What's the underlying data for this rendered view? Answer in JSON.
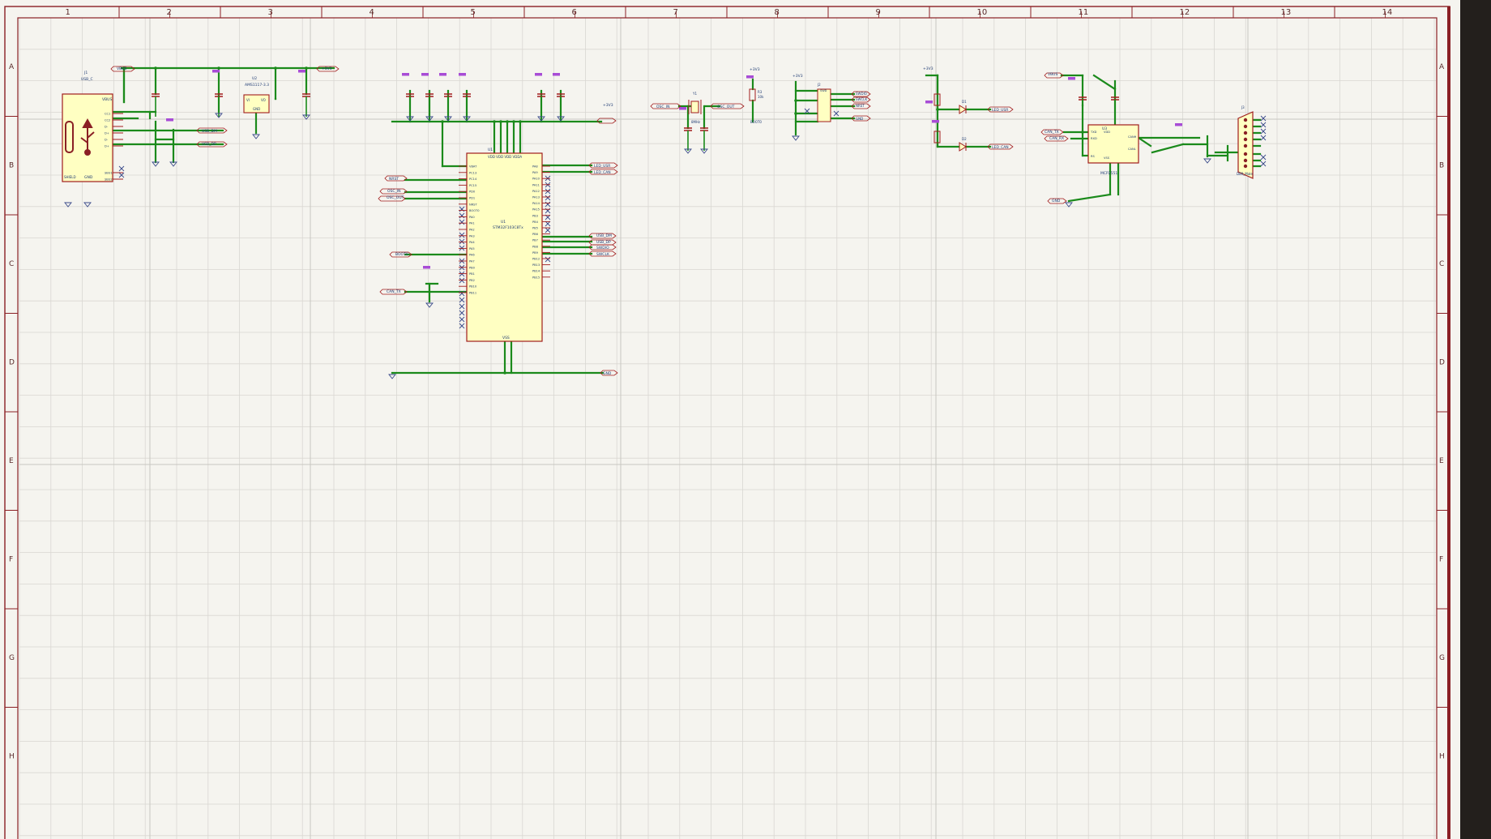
{
  "colors": {
    "background": "#f5f4ef",
    "frame": "#8a1f24",
    "grid": "#d9d7d2",
    "wire": "#1b8a1b",
    "component_fill": "#ffffc2",
    "component_stroke": "#a11d1d",
    "text": "#1f3b73",
    "power_flag": "#a84cd6",
    "no_connect": "#3a4a8a",
    "panel": "#231f1c"
  },
  "frame": {
    "columns": [
      "1",
      "2",
      "3",
      "4",
      "5",
      "6",
      "7",
      "8",
      "9",
      "10",
      "11",
      "12",
      "13",
      "14"
    ],
    "rows": [
      "A",
      "B",
      "C",
      "D",
      "E",
      "F",
      "G",
      "H"
    ]
  },
  "components": {
    "usb": {
      "ref": "J1",
      "value": "USB_C",
      "power_pin": "VBUS",
      "ground_pin": "GND",
      "shield_label": "SHIELD",
      "pins": [
        "CC1",
        "CC2",
        "D-",
        "D+",
        "D-",
        "D+",
        "SBU1",
        "SBU2"
      ]
    },
    "ldo": {
      "ref": "U2",
      "value": "AMS1117-3.3",
      "pin_in": "VI",
      "pin_out": "VO",
      "pin_gnd": "GND"
    },
    "mcu": {
      "ref": "U1",
      "value": "STM32F103C8Tx",
      "top_label": "VDD VDD VDD VDDA",
      "power_label": "VBAT",
      "ground_label": "VSS",
      "left_pins": [
        "VBAT",
        "PC13",
        "PC14",
        "PC15",
        "PD0",
        "PD1",
        "NRST",
        "BOOT0",
        "PA0",
        "PA1",
        "PA2",
        "PA3",
        "PA4",
        "PA5",
        "PA6",
        "PA7",
        "PB0",
        "PB1",
        "PB2",
        "PB10",
        "PB11"
      ],
      "right_pins": [
        "PA8",
        "PA9",
        "PA10",
        "PA11",
        "PA12",
        "PA13",
        "PA14",
        "PA15",
        "PB3",
        "PB4",
        "PB5",
        "PB6",
        "PB7",
        "PB8",
        "PB9",
        "PB12",
        "PB13",
        "PB14",
        "PB15"
      ]
    },
    "crystal": {
      "ref": "Y1",
      "value": "8MHz"
    },
    "resistor_boot": {
      "ref": "R3",
      "value": "10k"
    },
    "swd": {
      "ref": "J2",
      "value": "SWD"
    },
    "led1": {
      "ref": "D1",
      "value": "LED_USR"
    },
    "led2": {
      "ref": "D2",
      "value": "LED_CAN"
    },
    "can": {
      "ref": "U3",
      "value": "MCP2551",
      "pins": [
        "TXD",
        "RXD",
        "VDD",
        "VSS",
        "CANH",
        "CANL",
        "RS"
      ]
    },
    "db9": {
      "ref": "J3",
      "value": "DB9_Male"
    }
  },
  "nets": {
    "v33": "+3V3",
    "vbus": "VBUS",
    "gnd": "GND",
    "usb_dm": "USB_DM",
    "usb_dp": "USB_DP",
    "osc_in": "OSC_IN",
    "osc_out": "OSC_OUT",
    "nrst": "NRST",
    "boot0": "BOOT0",
    "swdio": "SWDIO",
    "swclk": "SWCLK",
    "can_tx": "CAN_TX",
    "can_rx": "CAN_RX",
    "led_usr": "LED_USR",
    "led_can": "LED_CAN"
  }
}
